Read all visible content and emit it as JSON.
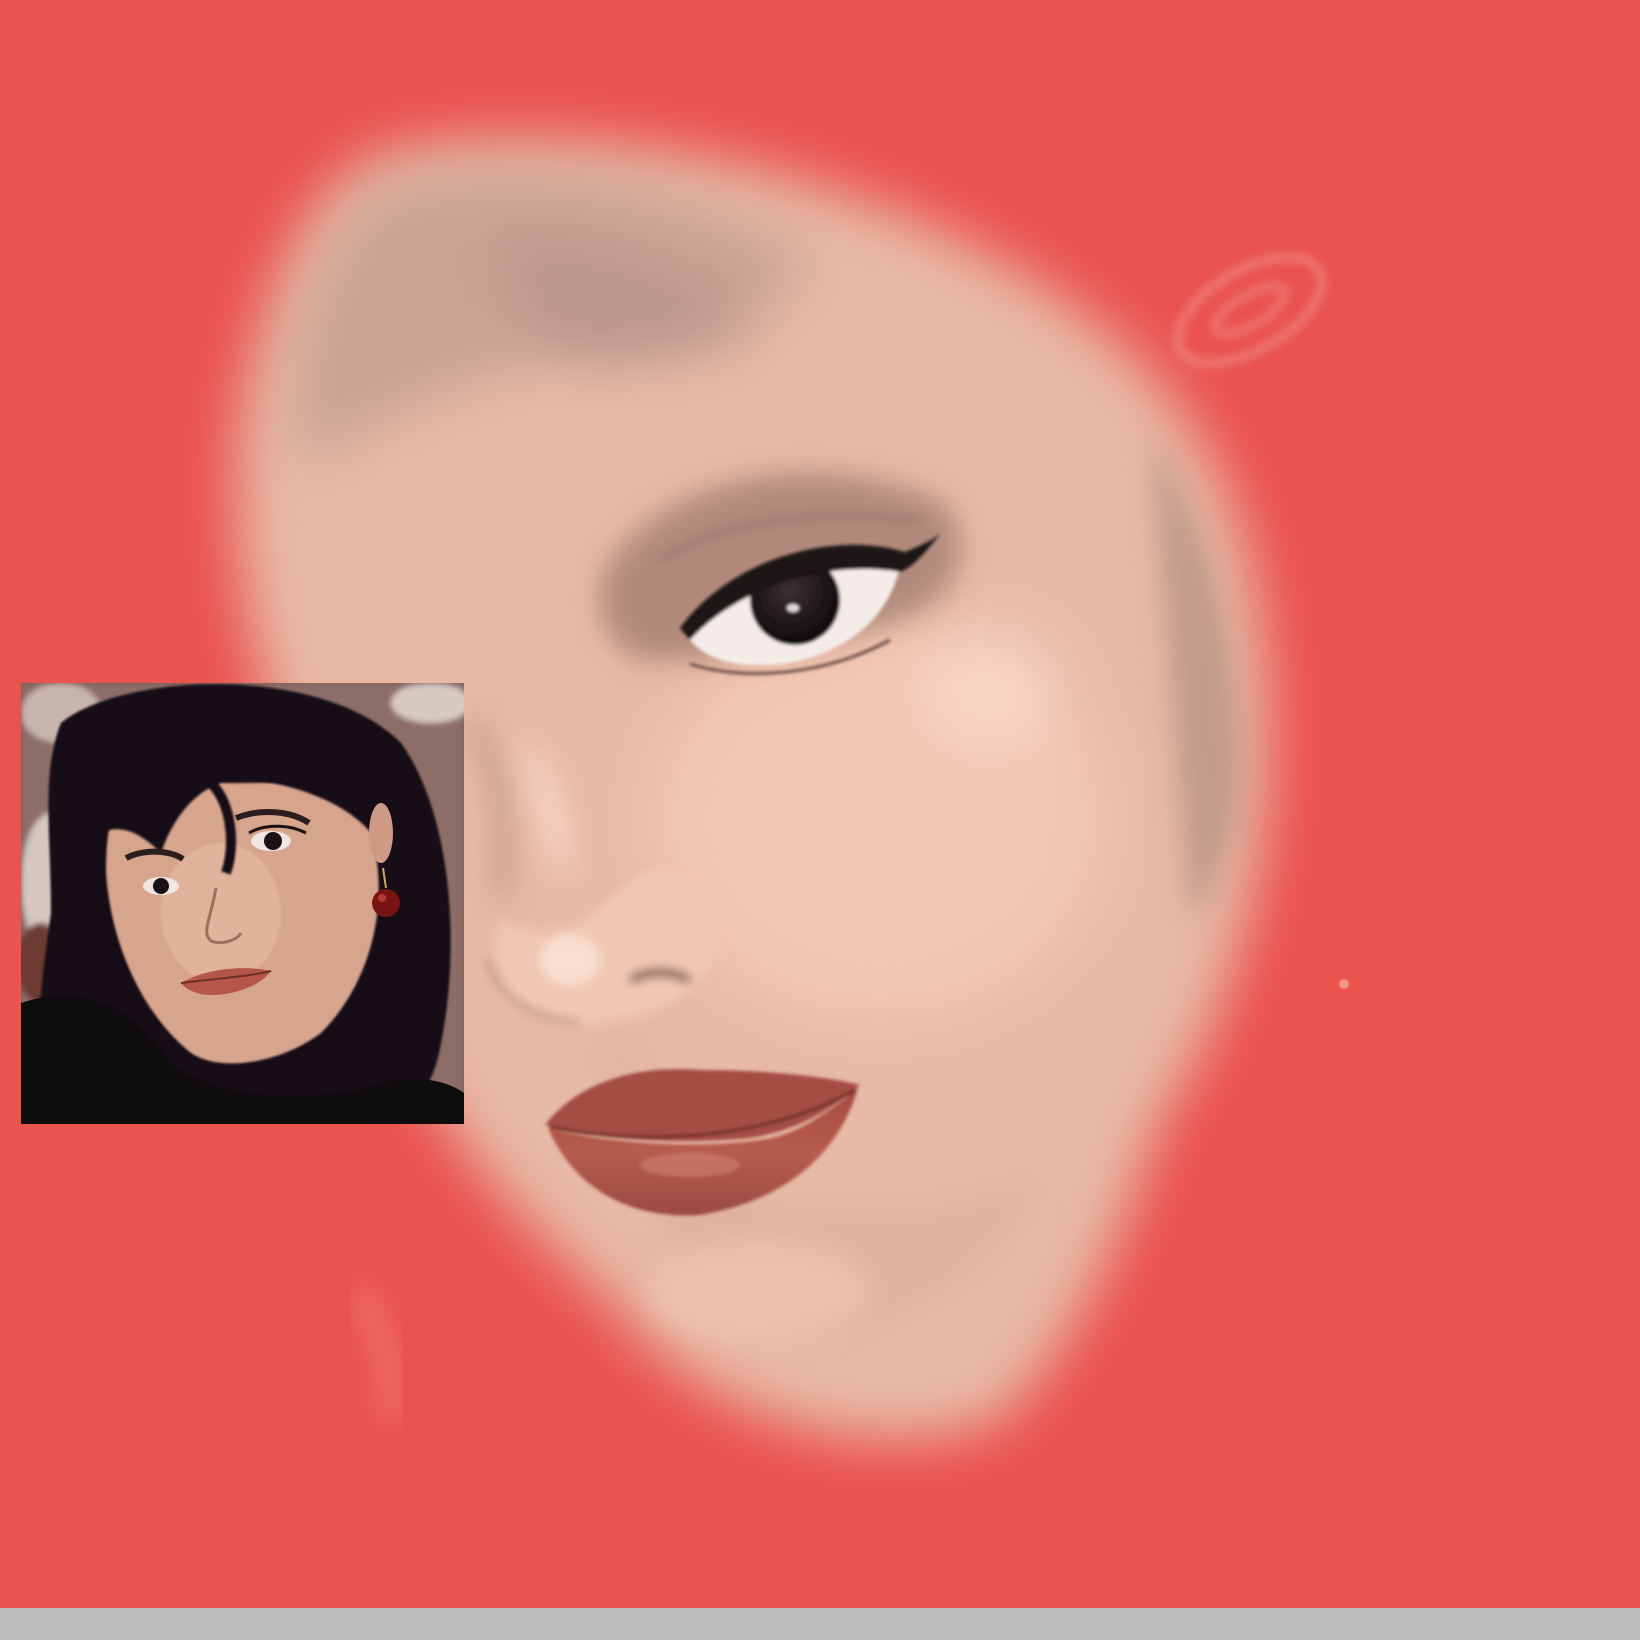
{
  "colors": {
    "canvas_background": "#EB534F",
    "skin_light": "#F2C4AF",
    "skin_mid": "#D9AC98",
    "skin_shadow": "#B89585",
    "lip": "#B4574A",
    "iris": "#1A1416",
    "hair": "#141012",
    "bottom_bar": "#BDBDBD"
  },
  "canvas": {
    "subject": "digital-portrait-painting-in-progress"
  },
  "reference_photo": {
    "subject": "reference-selfie-photo"
  },
  "bottom_bar": {
    "present": true
  }
}
